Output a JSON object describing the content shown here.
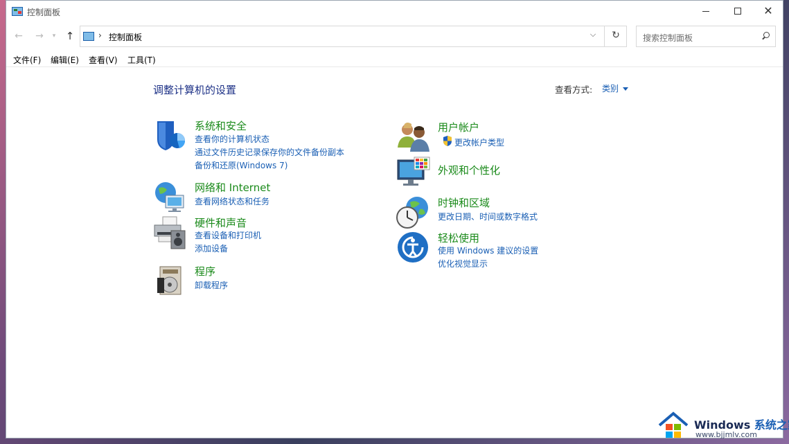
{
  "window": {
    "title": "控制面板",
    "minimize_glyph": "",
    "maximize_glyph": "",
    "close_glyph": "✕"
  },
  "nav": {
    "back_glyph": "←",
    "forward_glyph": "→",
    "history_glyph": "▾",
    "up_glyph": "↑",
    "address_separator": "›",
    "address_text": "控制面板",
    "address_dropdown_glyph": "⌵",
    "refresh_glyph": "↻",
    "search_placeholder": "搜索控制面板"
  },
  "menu": [
    "文件(F)",
    "编辑(E)",
    "查看(V)",
    "工具(T)"
  ],
  "main": {
    "heading": "调整计算机的设置",
    "view_by_label": "查看方式:",
    "view_by_value": "类别"
  },
  "categories": {
    "system_security": {
      "title": "系统和安全",
      "links": [
        "查看你的计算机状态",
        "通过文件历史记录保存你的文件备份副本",
        "备份和还原(Windows 7)"
      ],
      "icon": "shield-icon"
    },
    "network": {
      "title": "网络和 Internet",
      "links": [
        "查看网络状态和任务"
      ],
      "icon": "network-globe-icon"
    },
    "hardware": {
      "title": "硬件和声音",
      "links": [
        "查看设备和打印机",
        "添加设备"
      ],
      "icon": "printer-icon"
    },
    "programs": {
      "title": "程序",
      "links": [
        "卸载程序"
      ],
      "icon": "programs-disc-icon"
    },
    "user_accounts": {
      "title": "用户帐户",
      "links": [
        "更改帐户类型"
      ],
      "icon": "users-icon"
    },
    "appearance": {
      "title": "外观和个性化",
      "links": [],
      "icon": "monitor-palette-icon"
    },
    "clock_region": {
      "title": "时钟和区域",
      "links": [
        "更改日期、时间或数字格式"
      ],
      "icon": "clock-globe-icon"
    },
    "ease_access": {
      "title": "轻松使用",
      "links": [
        "使用 Windows 建议的设置",
        "优化视觉显示"
      ],
      "icon": "ease-of-access-icon"
    }
  },
  "watermark": {
    "brand_a": "Windows",
    "brand_b": "系统之家",
    "url": "www.bjjmlv.com"
  }
}
